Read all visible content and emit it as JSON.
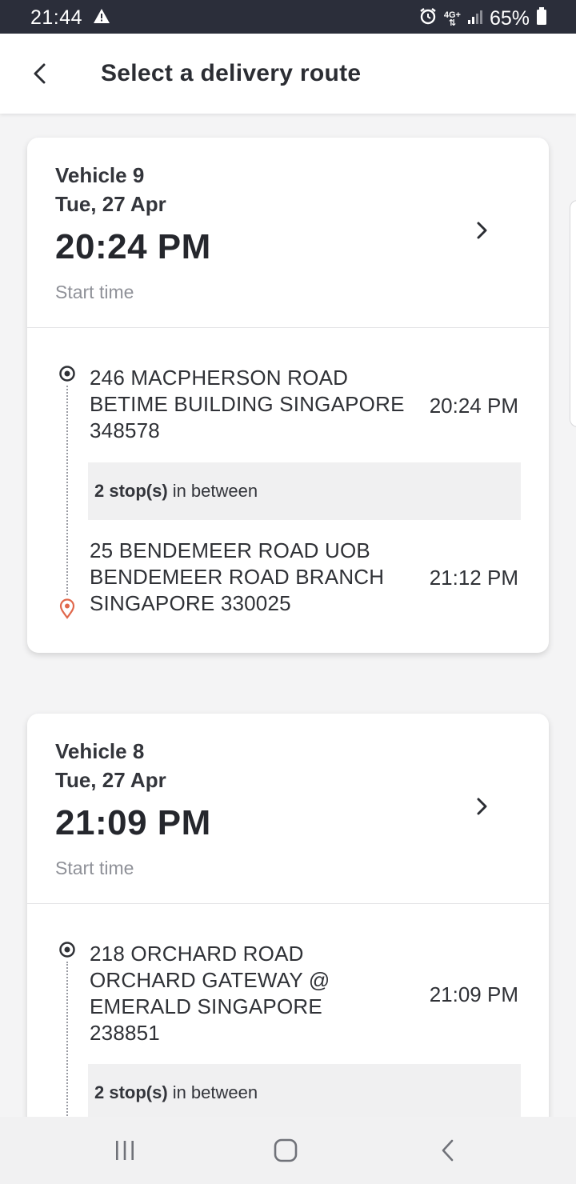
{
  "status_bar": {
    "time": "21:44",
    "network": "4G+",
    "battery": "65%"
  },
  "header": {
    "title": "Select a delivery route"
  },
  "routes": [
    {
      "vehicle": "Vehicle 9",
      "date": "Tue, 27 Apr",
      "start_time": "20:24 PM",
      "start_label": "Start time",
      "origin": {
        "address": "246 MACPHERSON ROAD BETIME BUILDING SINGAPORE 348578",
        "time": "20:24 PM"
      },
      "stops_count": "2 stop(s)",
      "stops_suffix": "in between",
      "destination": {
        "address": "25 BENDEMEER ROAD UOB BENDEMEER ROAD BRANCH SINGAPORE 330025",
        "time": "21:12 PM"
      }
    },
    {
      "vehicle": "Vehicle 8",
      "date": "Tue, 27 Apr",
      "start_time": "21:09 PM",
      "start_label": "Start time",
      "origin": {
        "address": "218 ORCHARD ROAD ORCHARD GATEWAY @ EMERALD SINGAPORE 238851",
        "time": "21:09 PM"
      },
      "stops_count": "2 stop(s)",
      "stops_suffix": "in between"
    }
  ],
  "colors": {
    "status_bar": "#2b2e3a",
    "destination_pin": "#e0674b",
    "text_primary": "#2b2d33",
    "text_muted": "#8f9198"
  }
}
